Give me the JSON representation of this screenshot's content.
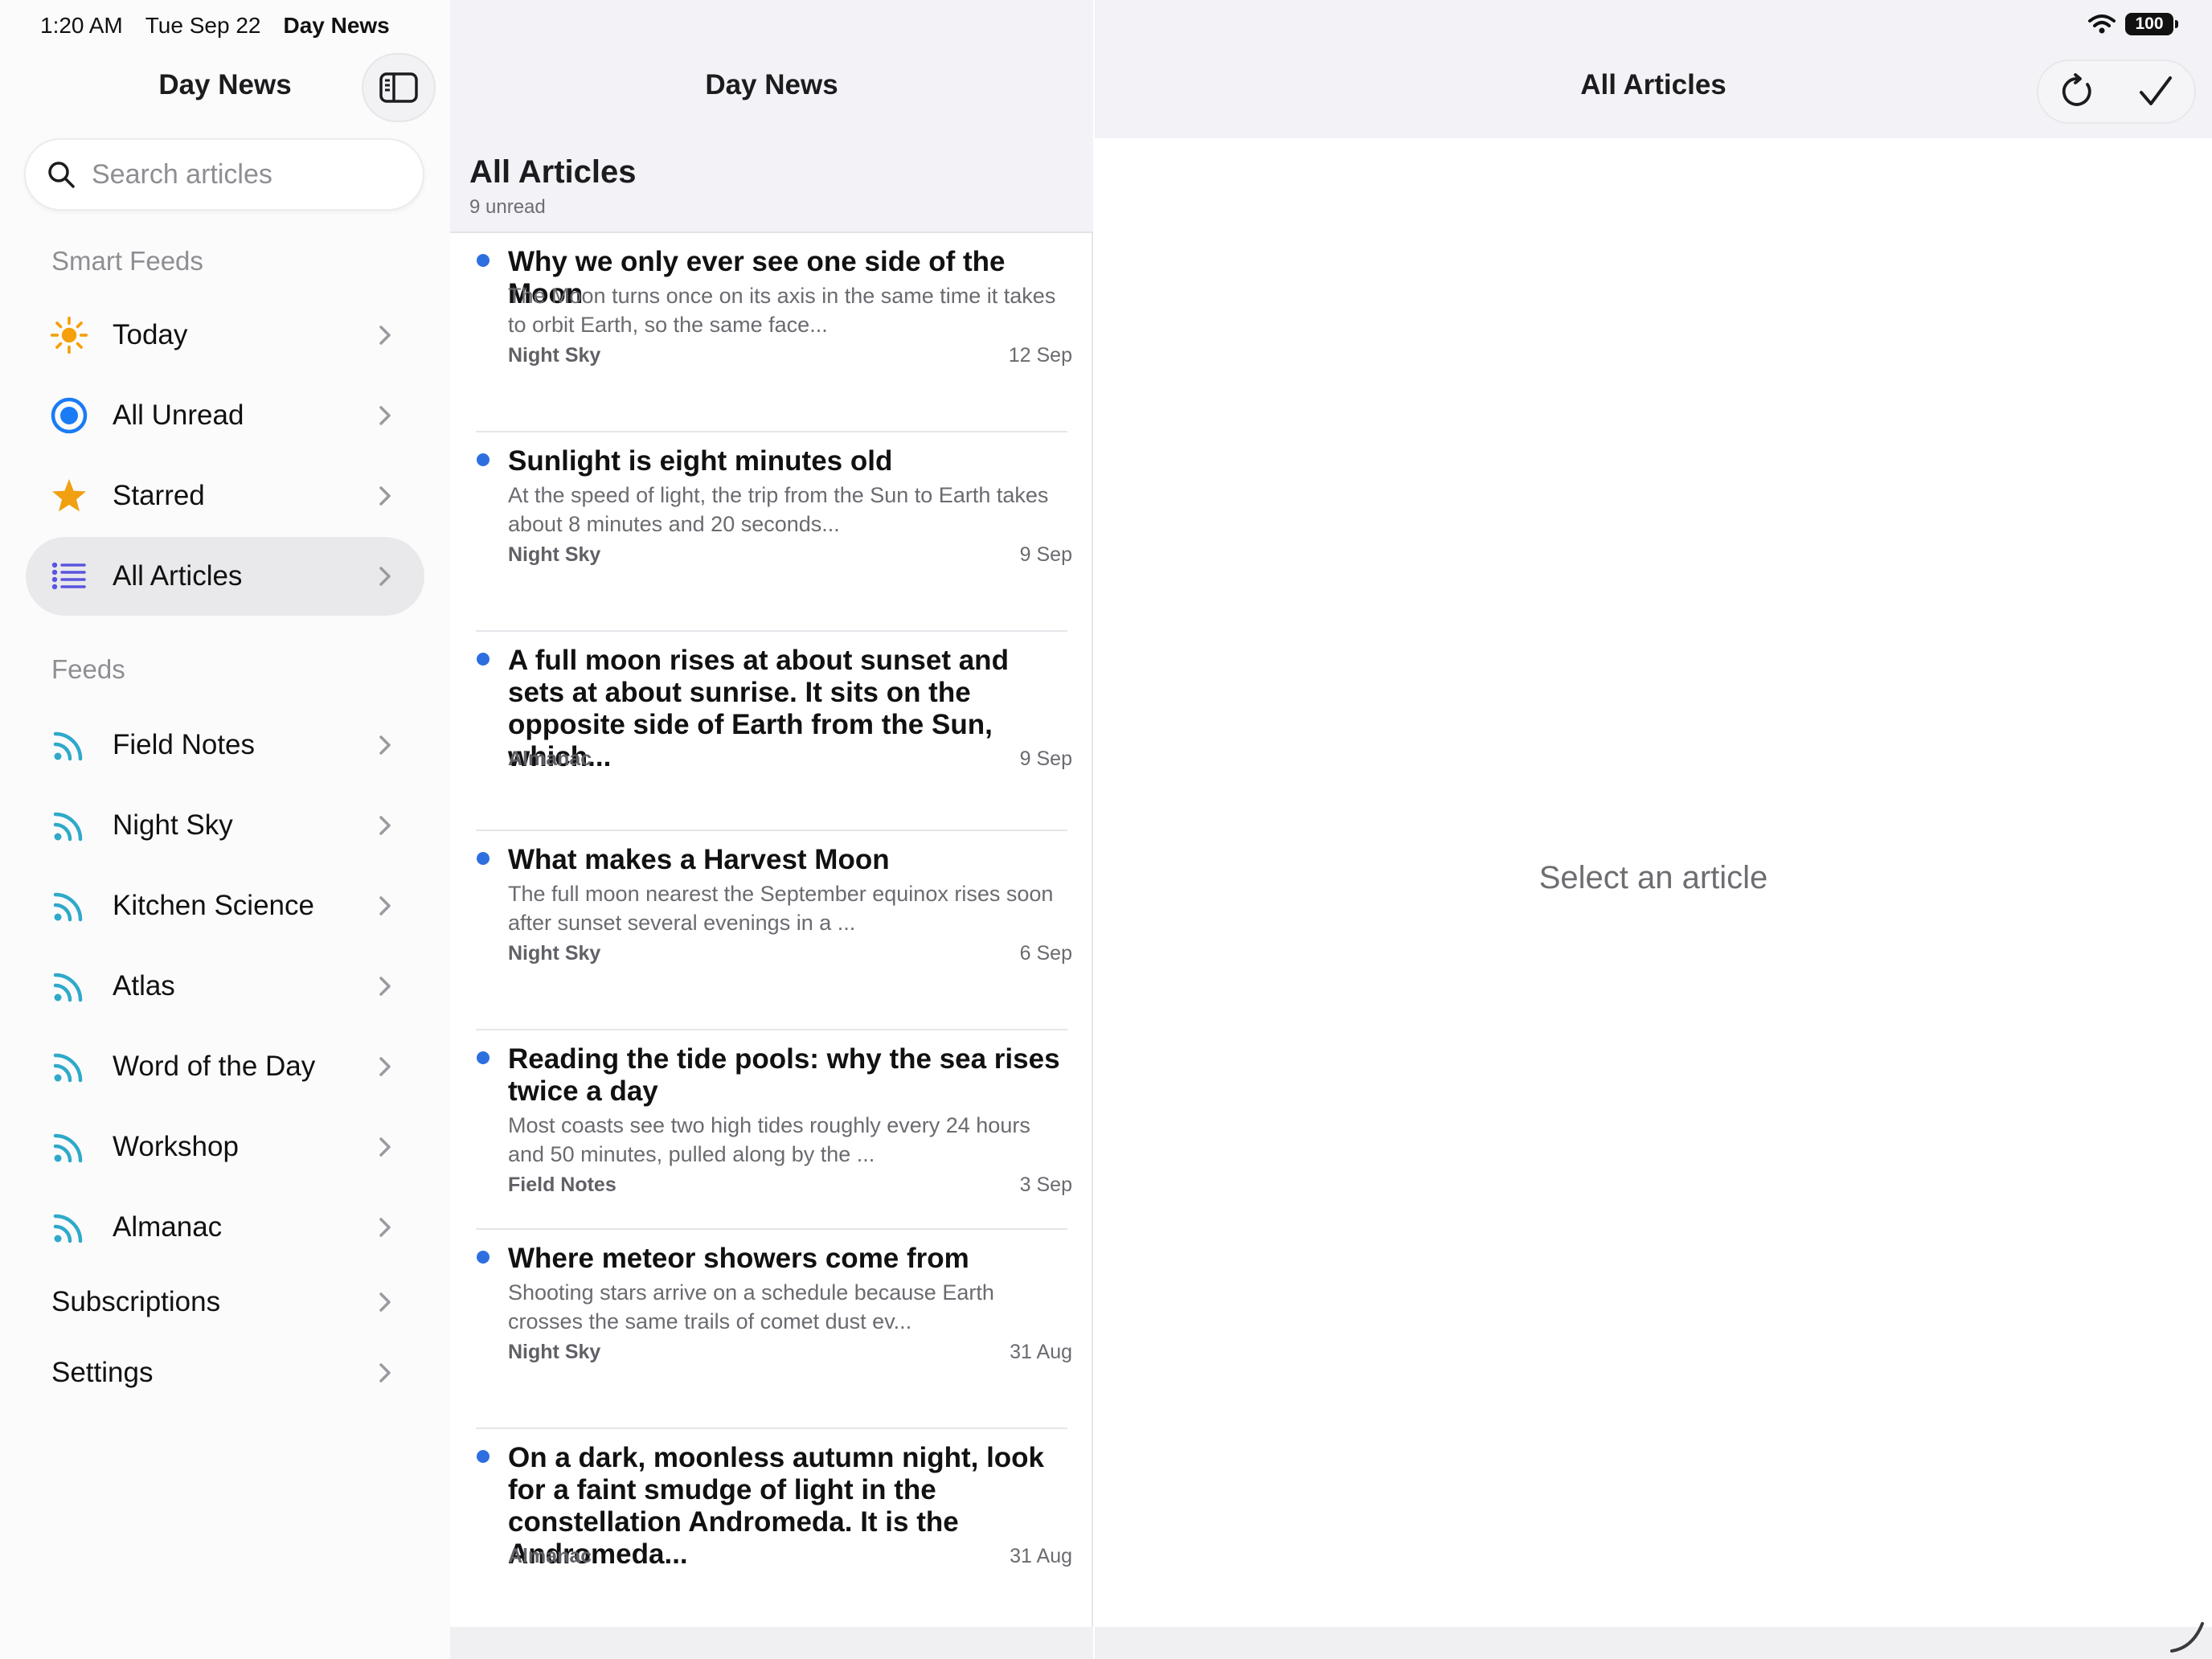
{
  "status_bar": {
    "time": "1:20 AM",
    "date": "Tue Sep 22",
    "app_name": "Day News",
    "battery": "100"
  },
  "sidebar": {
    "title": "Day News",
    "search_placeholder": "Search articles",
    "smart_feeds_header": "Smart Feeds",
    "smart_feeds": [
      {
        "label": "Today",
        "icon": "sun-icon",
        "color": "#f5a00a"
      },
      {
        "label": "All Unread",
        "icon": "unread-circle-icon",
        "color": "#1a7cf5"
      },
      {
        "label": "Starred",
        "icon": "star-icon",
        "color": "#f0a010"
      },
      {
        "label": "All Articles",
        "icon": "list-icon",
        "color": "#5a55e0",
        "selected": true
      }
    ],
    "feeds_header": "Feeds",
    "feeds": [
      {
        "label": "Field Notes",
        "icon": "rss-icon"
      },
      {
        "label": "Night Sky",
        "icon": "rss-icon"
      },
      {
        "label": "Kitchen Science",
        "icon": "rss-icon"
      },
      {
        "label": "Atlas",
        "icon": "rss-icon"
      },
      {
        "label": "Word of the Day",
        "icon": "rss-icon"
      },
      {
        "label": "Workshop",
        "icon": "rss-icon"
      },
      {
        "label": "Almanac",
        "icon": "rss-icon"
      }
    ],
    "subscriptions_label": "Subscriptions",
    "settings_label": "Settings"
  },
  "middle": {
    "title": "Day News",
    "list_title": "All Articles",
    "unread_count": "9 unread",
    "articles": [
      {
        "title": "Why we only ever see one side of the Moon",
        "snippet": "The Moon turns once on its axis in the same time it takes to orbit Earth, so the same face...",
        "feed": "Night Sky",
        "date": "12 Sep",
        "unread": true
      },
      {
        "title": "Sunlight is eight minutes old",
        "snippet": "At the speed of light, the trip from the Sun to Earth takes about 8 minutes and 20 seconds...",
        "feed": "Night Sky",
        "date": "9 Sep",
        "unread": true
      },
      {
        "title": "A full moon rises at about sunset and sets at about sunrise. It sits on the opposite side of Earth from the Sun, which...",
        "snippet": "",
        "feed": "Almanac",
        "date": "9 Sep",
        "unread": true
      },
      {
        "title": "What makes a Harvest Moon",
        "snippet": "The full moon nearest the September equinox rises soon after sunset several evenings in a ...",
        "feed": "Night Sky",
        "date": "6 Sep",
        "unread": true
      },
      {
        "title": "Reading the tide pools: why the sea rises twice a day",
        "snippet": "Most coasts see two high tides roughly every 24 hours and 50 minutes, pulled along by the ...",
        "feed": "Field Notes",
        "date": "3 Sep",
        "unread": true
      },
      {
        "title": "Where meteor showers come from",
        "snippet": "Shooting stars arrive on a schedule because Earth crosses the same trails of comet dust ev...",
        "feed": "Night Sky",
        "date": "31 Aug",
        "unread": true
      },
      {
        "title": "On a dark, moonless autumn night, look for a faint smudge of light in the constellation Andromeda. It is the Andromeda...",
        "snippet": "",
        "feed": "Almanac",
        "date": "31 Aug",
        "unread": true
      }
    ]
  },
  "detail": {
    "title": "All Articles",
    "empty_text": "Select an article",
    "actions": [
      "refresh-icon",
      "mark-all-read-checkmark-icon"
    ]
  },
  "colors": {
    "accent": "#2e6fe0",
    "rss": "#2fa9c9",
    "selected_row": "#e9e9ec",
    "bar_background": "#f2f2f7"
  }
}
